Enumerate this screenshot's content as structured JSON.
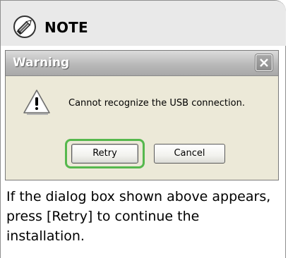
{
  "note": {
    "title": "NOTE",
    "icon": "pencil-icon"
  },
  "dialog": {
    "title": "Warning",
    "close_icon": "close-icon",
    "warning_icon": "warning-icon",
    "message": "Cannot recognize the USB connection.",
    "buttons": {
      "retry": "Retry",
      "cancel": "Cancel"
    },
    "highlight_color": "#56b84d"
  },
  "instruction": "If the dialog box shown above appears, press [Retry] to continue the installation."
}
